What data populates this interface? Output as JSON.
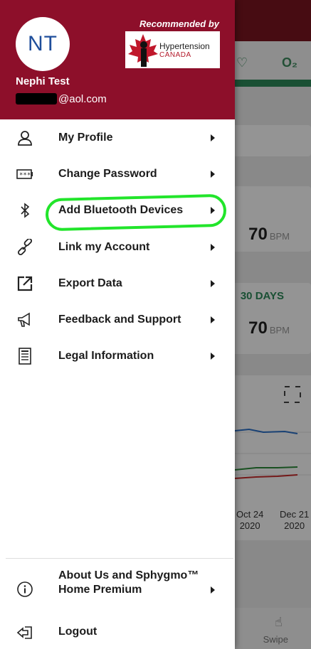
{
  "drawer": {
    "avatar_initials": "NT",
    "user_name": "Nephi Test",
    "email_suffix": "@aol.com",
    "recommended_label": "Recommended by",
    "partner": {
      "name": "Hypertension",
      "country": "CANADA"
    }
  },
  "menu": {
    "items": [
      {
        "label": "My Profile",
        "icon": "person-icon"
      },
      {
        "label": "Change Password",
        "icon": "password-icon"
      },
      {
        "label": "Add Bluetooth Devices",
        "icon": "bluetooth-icon"
      },
      {
        "label": "Link my Account",
        "icon": "link-icon"
      },
      {
        "label": "Export Data",
        "icon": "export-icon"
      },
      {
        "label": "Feedback and Support",
        "icon": "megaphone-icon"
      },
      {
        "label": "Legal Information",
        "icon": "document-icon"
      }
    ],
    "about_label": "About Us and Sphygmo™ Home Premium",
    "logout_label": "Logout"
  },
  "background": {
    "metric_o2": "O₂",
    "bpm_value_1": "70",
    "bpm_unit_1": "BPM",
    "days_label": "30 DAYS",
    "bpm_value_2": "70",
    "bpm_unit_2": "BPM",
    "date_1": "Oct 24",
    "year_1": "2020",
    "date_2": "Dec 21",
    "year_2": "2020",
    "swipe_label": "Swipe"
  },
  "colors": {
    "header": "#8d0f2a",
    "highlight": "#22e52b",
    "accent_green": "#2e8a5a"
  }
}
